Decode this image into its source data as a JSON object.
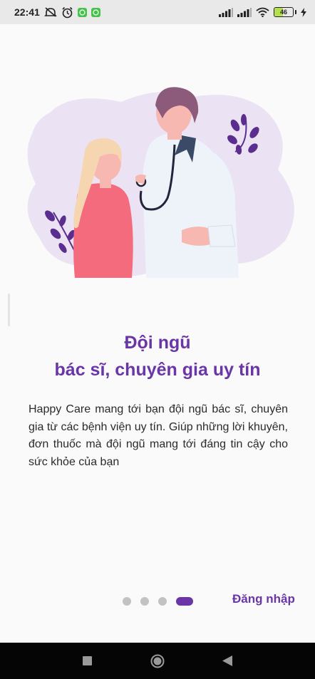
{
  "status_bar": {
    "time": "22:41",
    "battery_level": "46",
    "battery_fraction": 0.46
  },
  "onboarding": {
    "title_line1": "Đội ngũ",
    "title_line2": "bác sĩ, chuyên gia uy tín",
    "description": "Happy Care mang tới bạn đội ngũ bác sĩ, chuyên gia từ các bệnh viện uy tín. Giúp những lời khuyên, đơn thuốc mà đội ngũ mang tới đáng tin cậy cho sức khỏe của bạn",
    "page_index": 4,
    "page_count": 4,
    "login_label": "Đăng nhập"
  },
  "colors": {
    "accent": "#6a35a6",
    "blob": "#ebe3f3",
    "dot_inactive": "#c2c2c2",
    "status_bar_bg": "#e9e9e9",
    "nav_bar_bg": "#050505"
  },
  "icons": {
    "status_left": [
      "mute-icon",
      "alarm-icon",
      "app-notification-icon",
      "app-notification-icon"
    ],
    "status_right": [
      "signal-icon",
      "signal-icon",
      "wifi-icon",
      "battery-icon",
      "charging-icon"
    ],
    "nav": [
      "recent-apps-icon",
      "home-icon",
      "back-icon"
    ]
  }
}
